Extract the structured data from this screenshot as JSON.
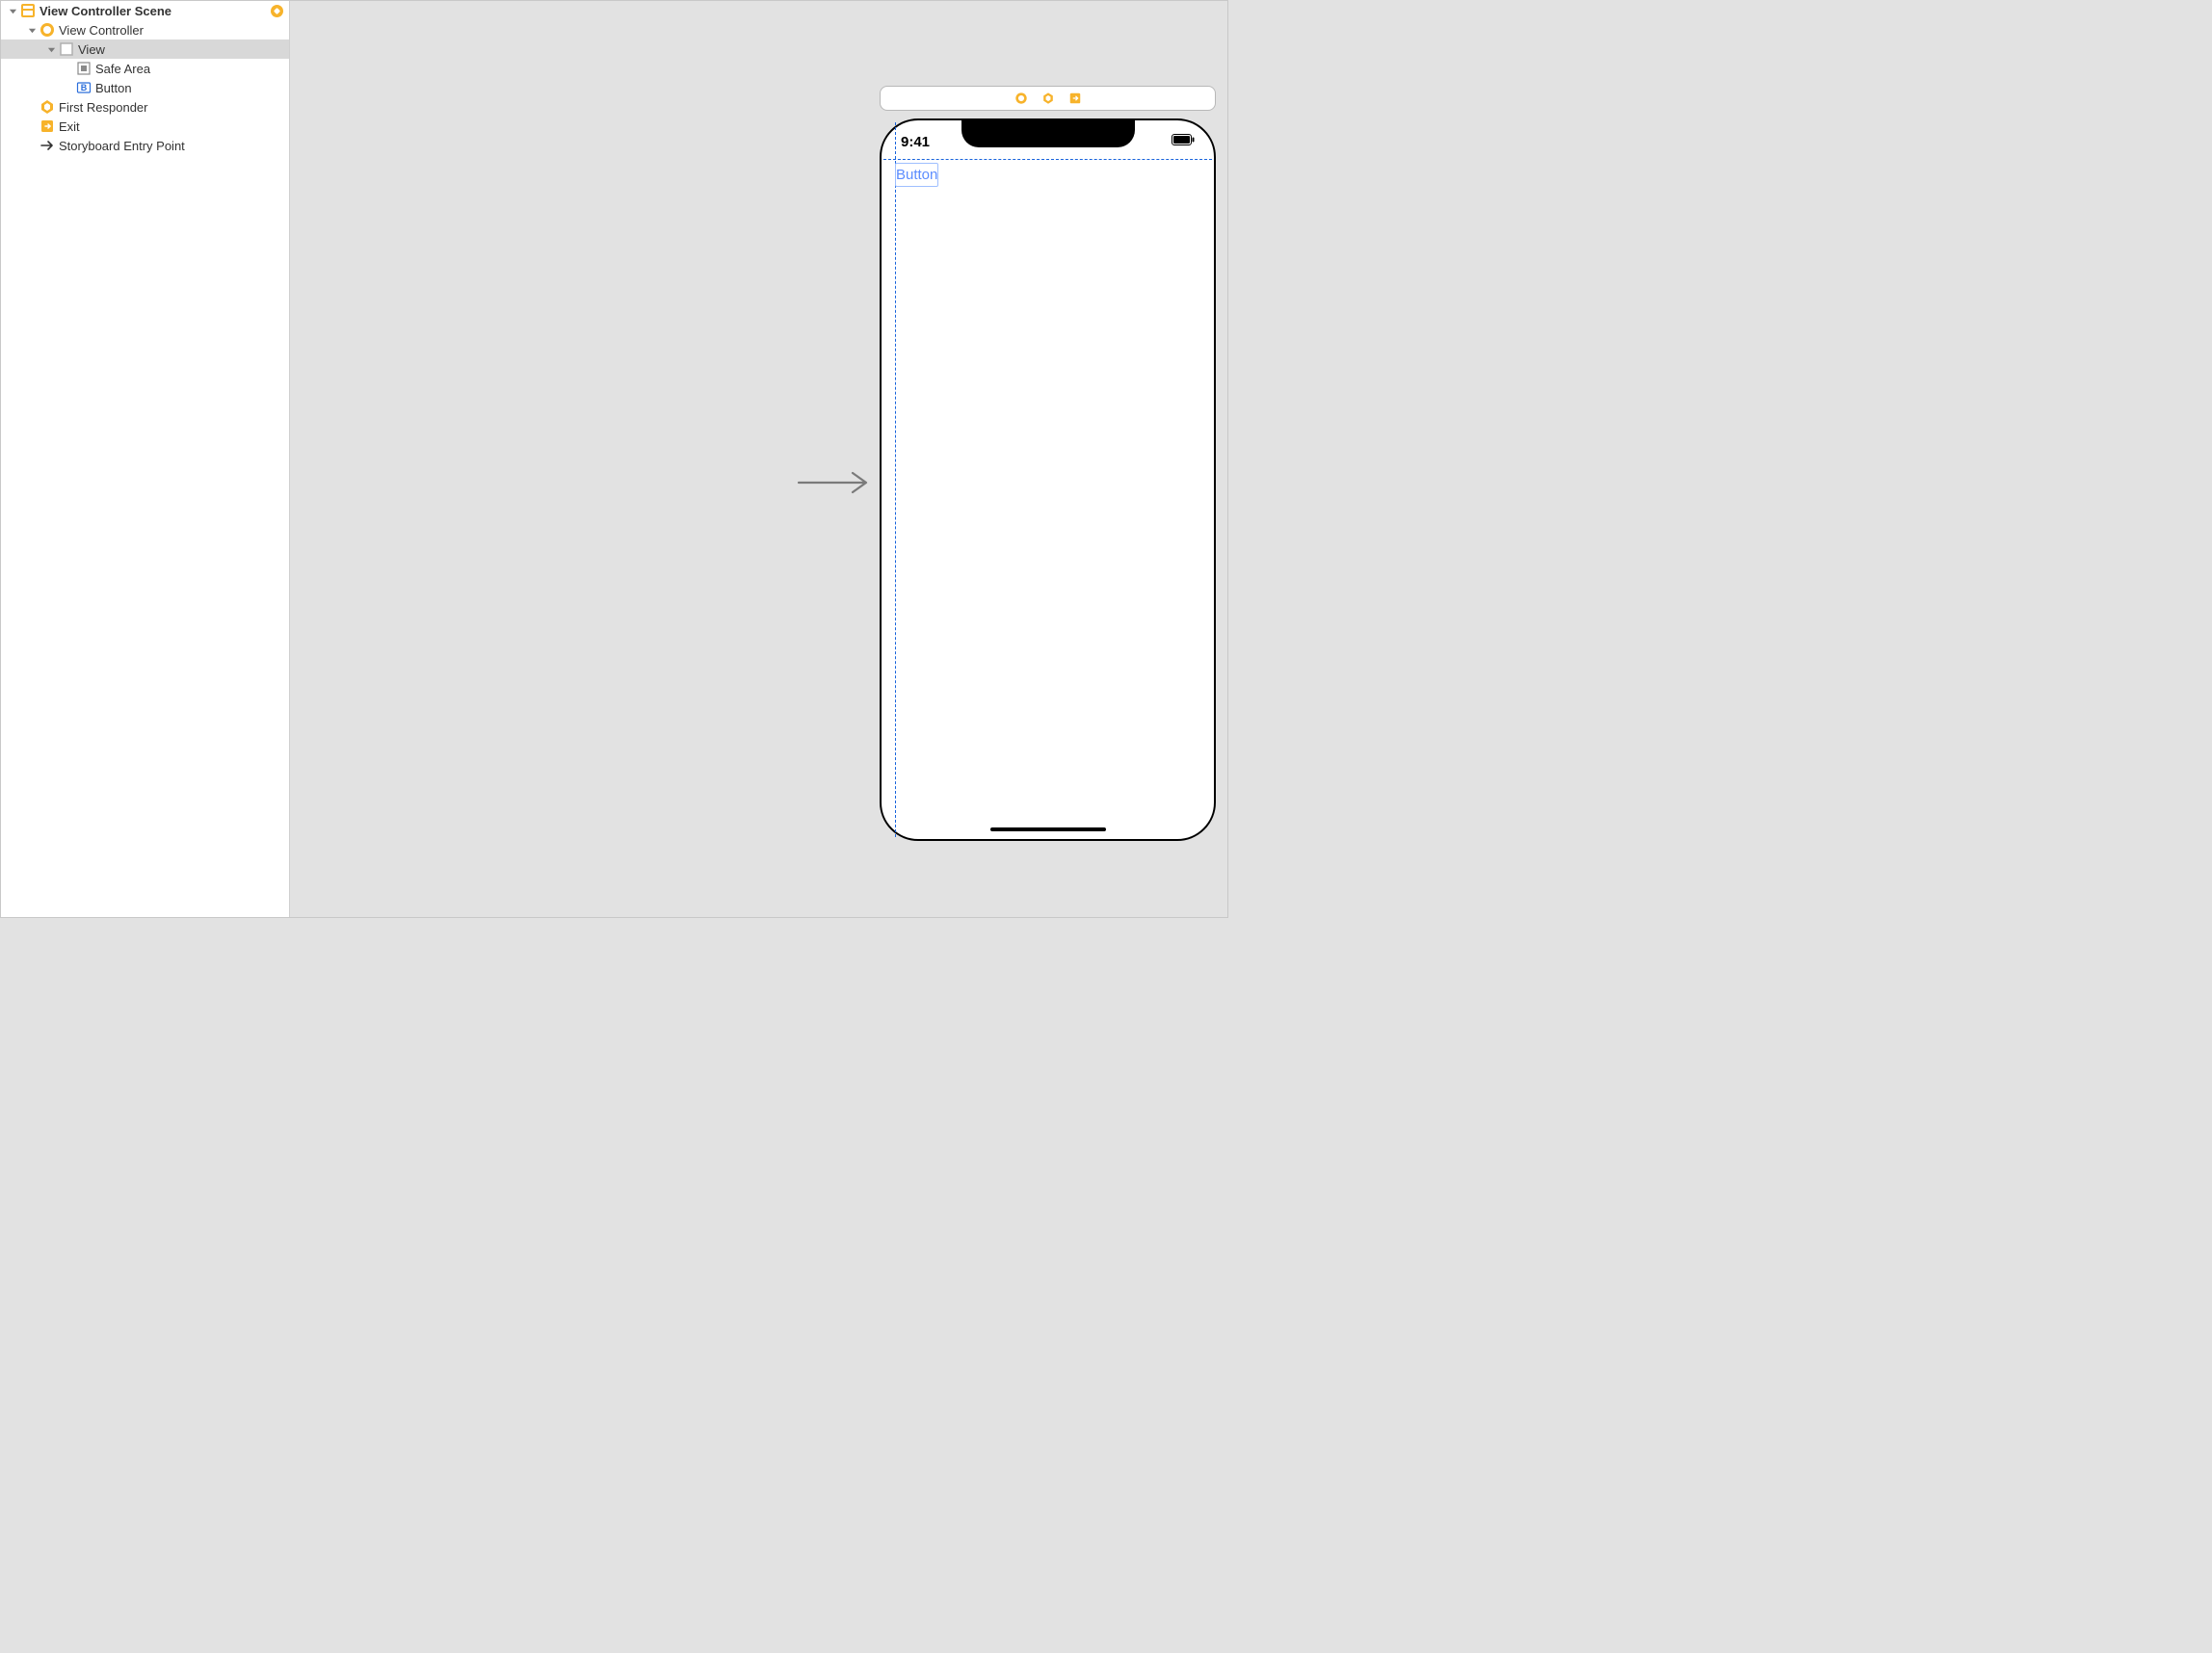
{
  "outline": {
    "scene_title": "View Controller Scene",
    "items": [
      {
        "label": "View Controller"
      },
      {
        "label": "View"
      },
      {
        "label": "Safe Area"
      },
      {
        "label": "Button"
      },
      {
        "label": "First Responder"
      },
      {
        "label": "Exit"
      },
      {
        "label": "Storyboard Entry Point"
      }
    ]
  },
  "device": {
    "status_time": "9:41",
    "button_label": "Button"
  },
  "colors": {
    "accent": "#F7B32B",
    "guide": "#1863DC",
    "tint": "#5C8DFF"
  }
}
